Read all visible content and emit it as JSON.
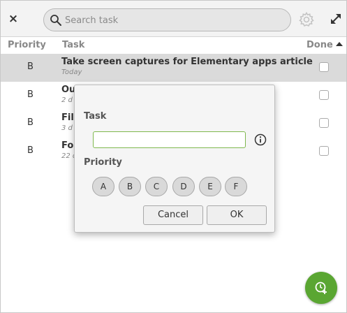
{
  "header": {
    "close_glyph": "×",
    "search_placeholder": "Search task",
    "settings_icon": "gear-icon",
    "fullscreen_icon": "fullscreen-icon"
  },
  "columns": {
    "priority": "Priority",
    "task": "Task",
    "done": "Done"
  },
  "rows": [
    {
      "priority": "B",
      "title": "Take screen captures for Elementary apps article",
      "subtitle": "Today",
      "done": false,
      "selected": true
    },
    {
      "priority": "B",
      "title": "Ou",
      "subtitle": "2 d",
      "done": false,
      "selected": false
    },
    {
      "priority": "B",
      "title": "Fill",
      "subtitle": "3 d",
      "done": false,
      "selected": false
    },
    {
      "priority": "B",
      "title": "Fol",
      "subtitle": "22 d",
      "done": false,
      "selected": false
    }
  ],
  "dialog": {
    "task_label": "Task",
    "task_value": "",
    "priority_label": "Priority",
    "priorities": [
      "A",
      "B",
      "C",
      "D",
      "E",
      "F"
    ],
    "cancel_label": "Cancel",
    "ok_label": "OK"
  },
  "colors": {
    "accent_green": "#5aa632",
    "input_focus": "#7fb84e",
    "selected_row": "#dadada"
  }
}
